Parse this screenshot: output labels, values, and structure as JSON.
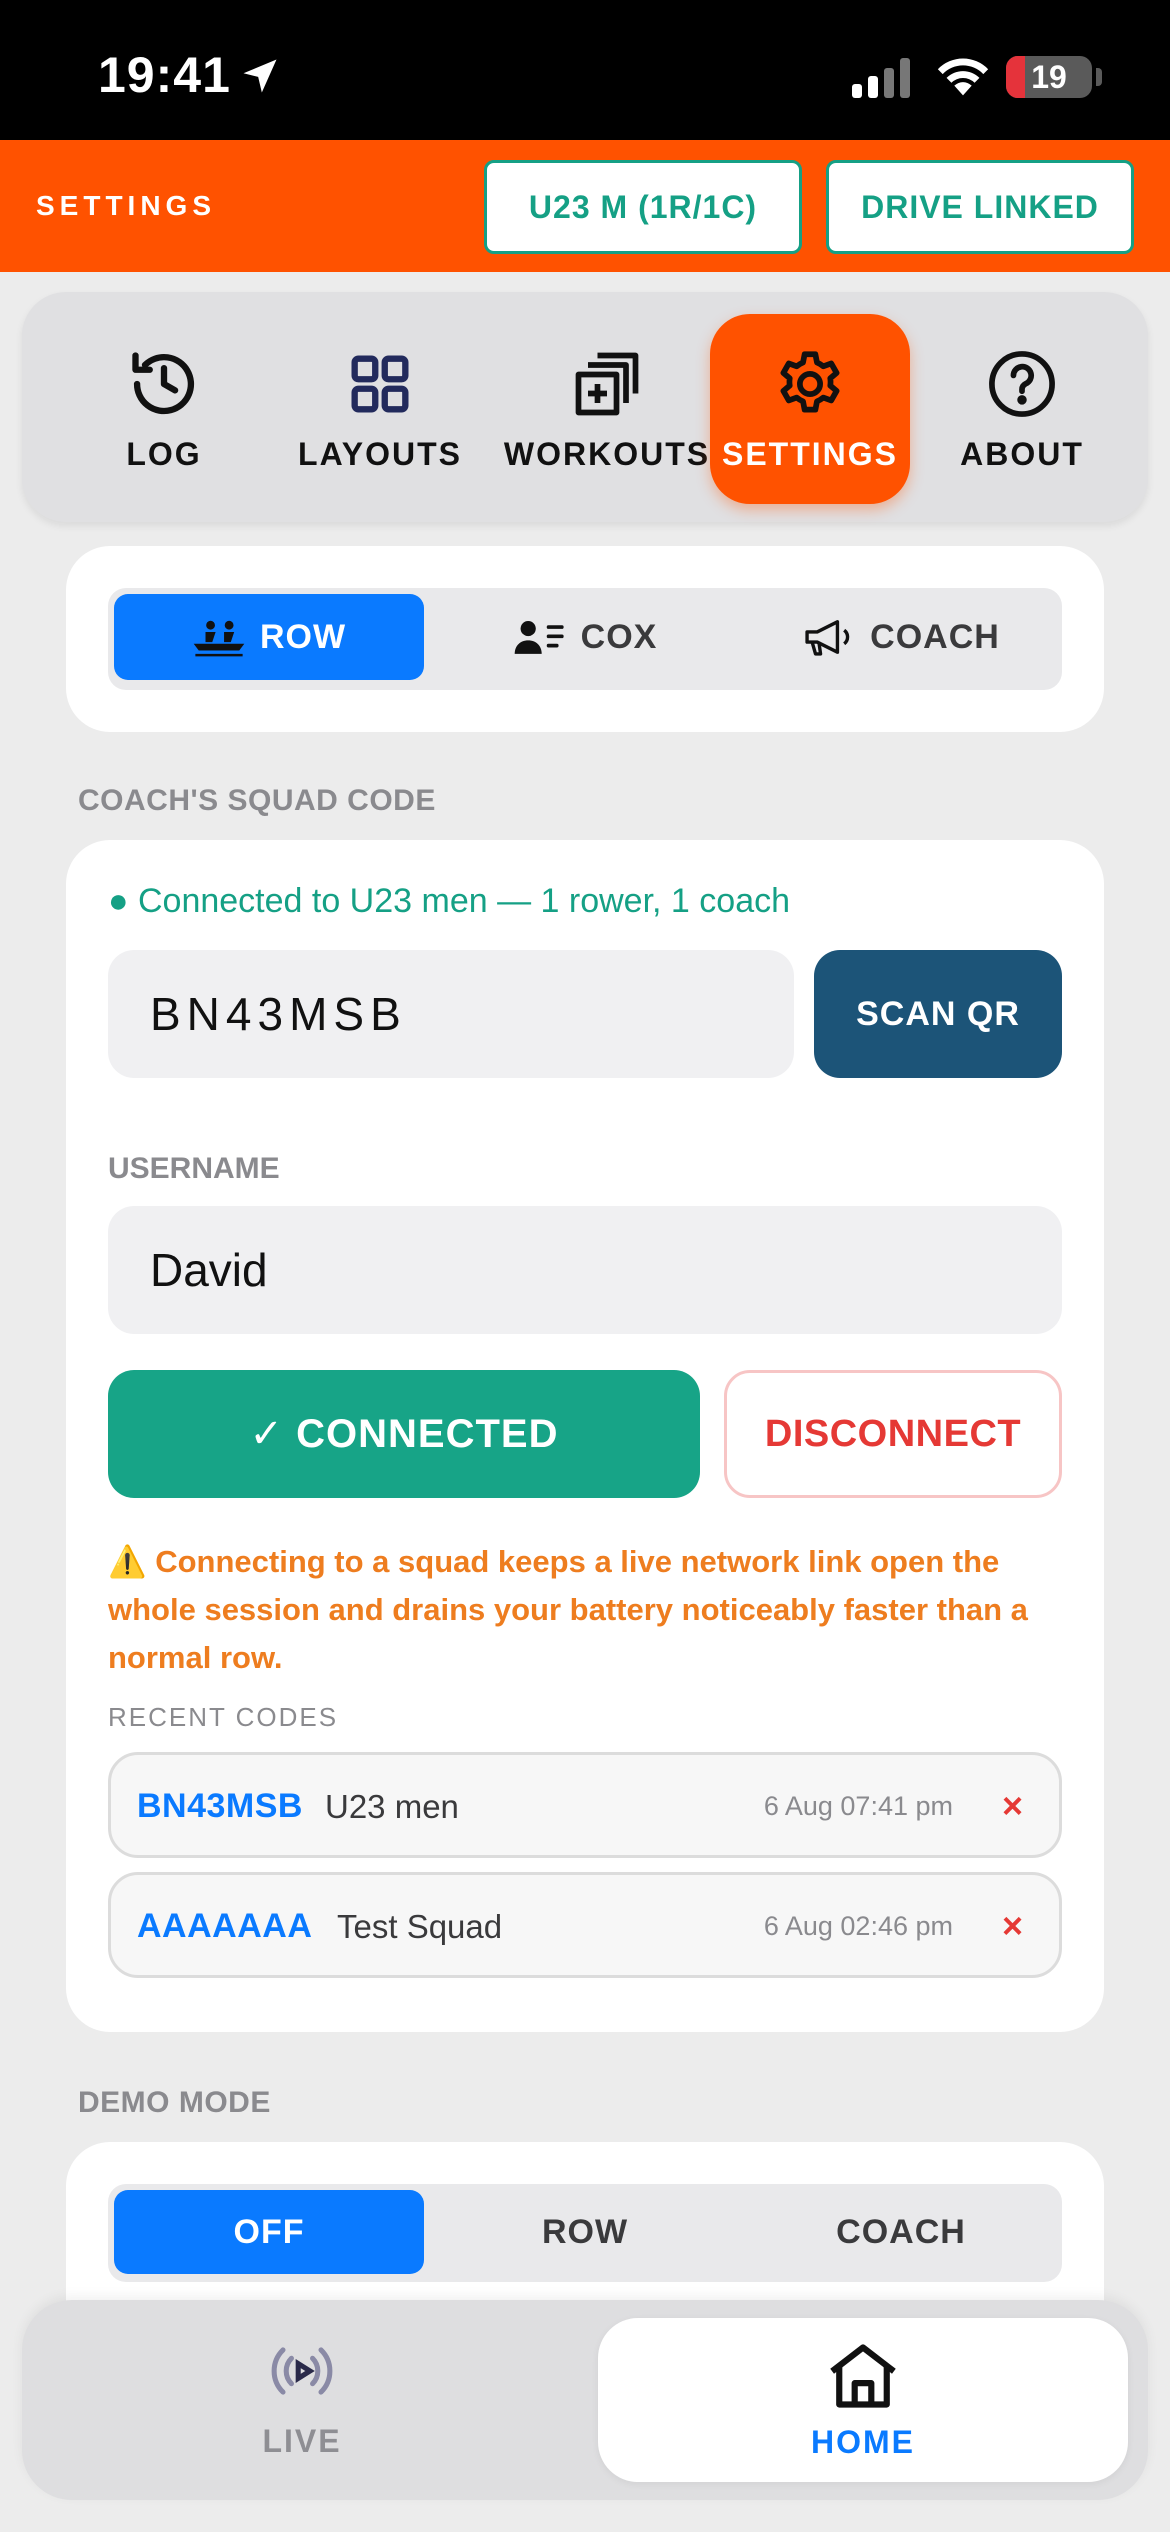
{
  "status_bar": {
    "time": "19:41",
    "battery": "19"
  },
  "header": {
    "title": "SETTINGS",
    "squad_pill": "U23 M (1R/1C)",
    "drive_pill": "DRIVE LINKED"
  },
  "nav": {
    "tabs": [
      {
        "label": "LOG",
        "icon": "history-icon"
      },
      {
        "label": "LAYOUTS",
        "icon": "grid-icon"
      },
      {
        "label": "WORKOUTS",
        "icon": "add-stack-icon"
      },
      {
        "label": "SETTINGS",
        "icon": "gear-icon",
        "active": true
      },
      {
        "label": "ABOUT",
        "icon": "help-icon"
      }
    ]
  },
  "role": {
    "options": [
      {
        "label": "ROW",
        "icon": "rowing-icon",
        "active": true
      },
      {
        "label": "COX",
        "icon": "cox-list-icon"
      },
      {
        "label": "COACH",
        "icon": "megaphone-icon"
      }
    ]
  },
  "squad": {
    "section_label": "COACH'S SQUAD CODE",
    "status": "● Connected to U23 men — 1 rower, 1 coach",
    "code": "BN43MSB",
    "scan_label": "SCAN QR",
    "username_label": "USERNAME",
    "username": "David",
    "connected_label": "✓ CONNECTED",
    "disconnect_label": "DISCONNECT",
    "warning": "⚠️ Connecting to a squad keeps a live network link open the whole session and drains your battery noticeably faster than a normal row.",
    "recent_label": "RECENT CODES",
    "recent": [
      {
        "code": "BN43MSB",
        "name": "U23 men",
        "time": "6 Aug 07:41 pm",
        "remove": "×"
      },
      {
        "code": "AAAAAAA",
        "name": "Test Squad",
        "time": "6 Aug 02:46 pm",
        "remove": "×"
      }
    ]
  },
  "demo": {
    "section_label": "DEMO MODE",
    "options": [
      {
        "label": "OFF",
        "active": true
      },
      {
        "label": "ROW"
      },
      {
        "label": "COACH"
      }
    ]
  },
  "bottom_nav": {
    "live": {
      "label": "LIVE",
      "icon": "live-broadcast-icon"
    },
    "home": {
      "label": "HOME",
      "icon": "home-icon",
      "active": true
    }
  },
  "colors": {
    "accent_orange": "#ff5200",
    "teal": "#15a085",
    "blue": "#0a7aff",
    "navy": "#1c5478",
    "danger": "#e53935",
    "warning": "#ee7d1f"
  }
}
